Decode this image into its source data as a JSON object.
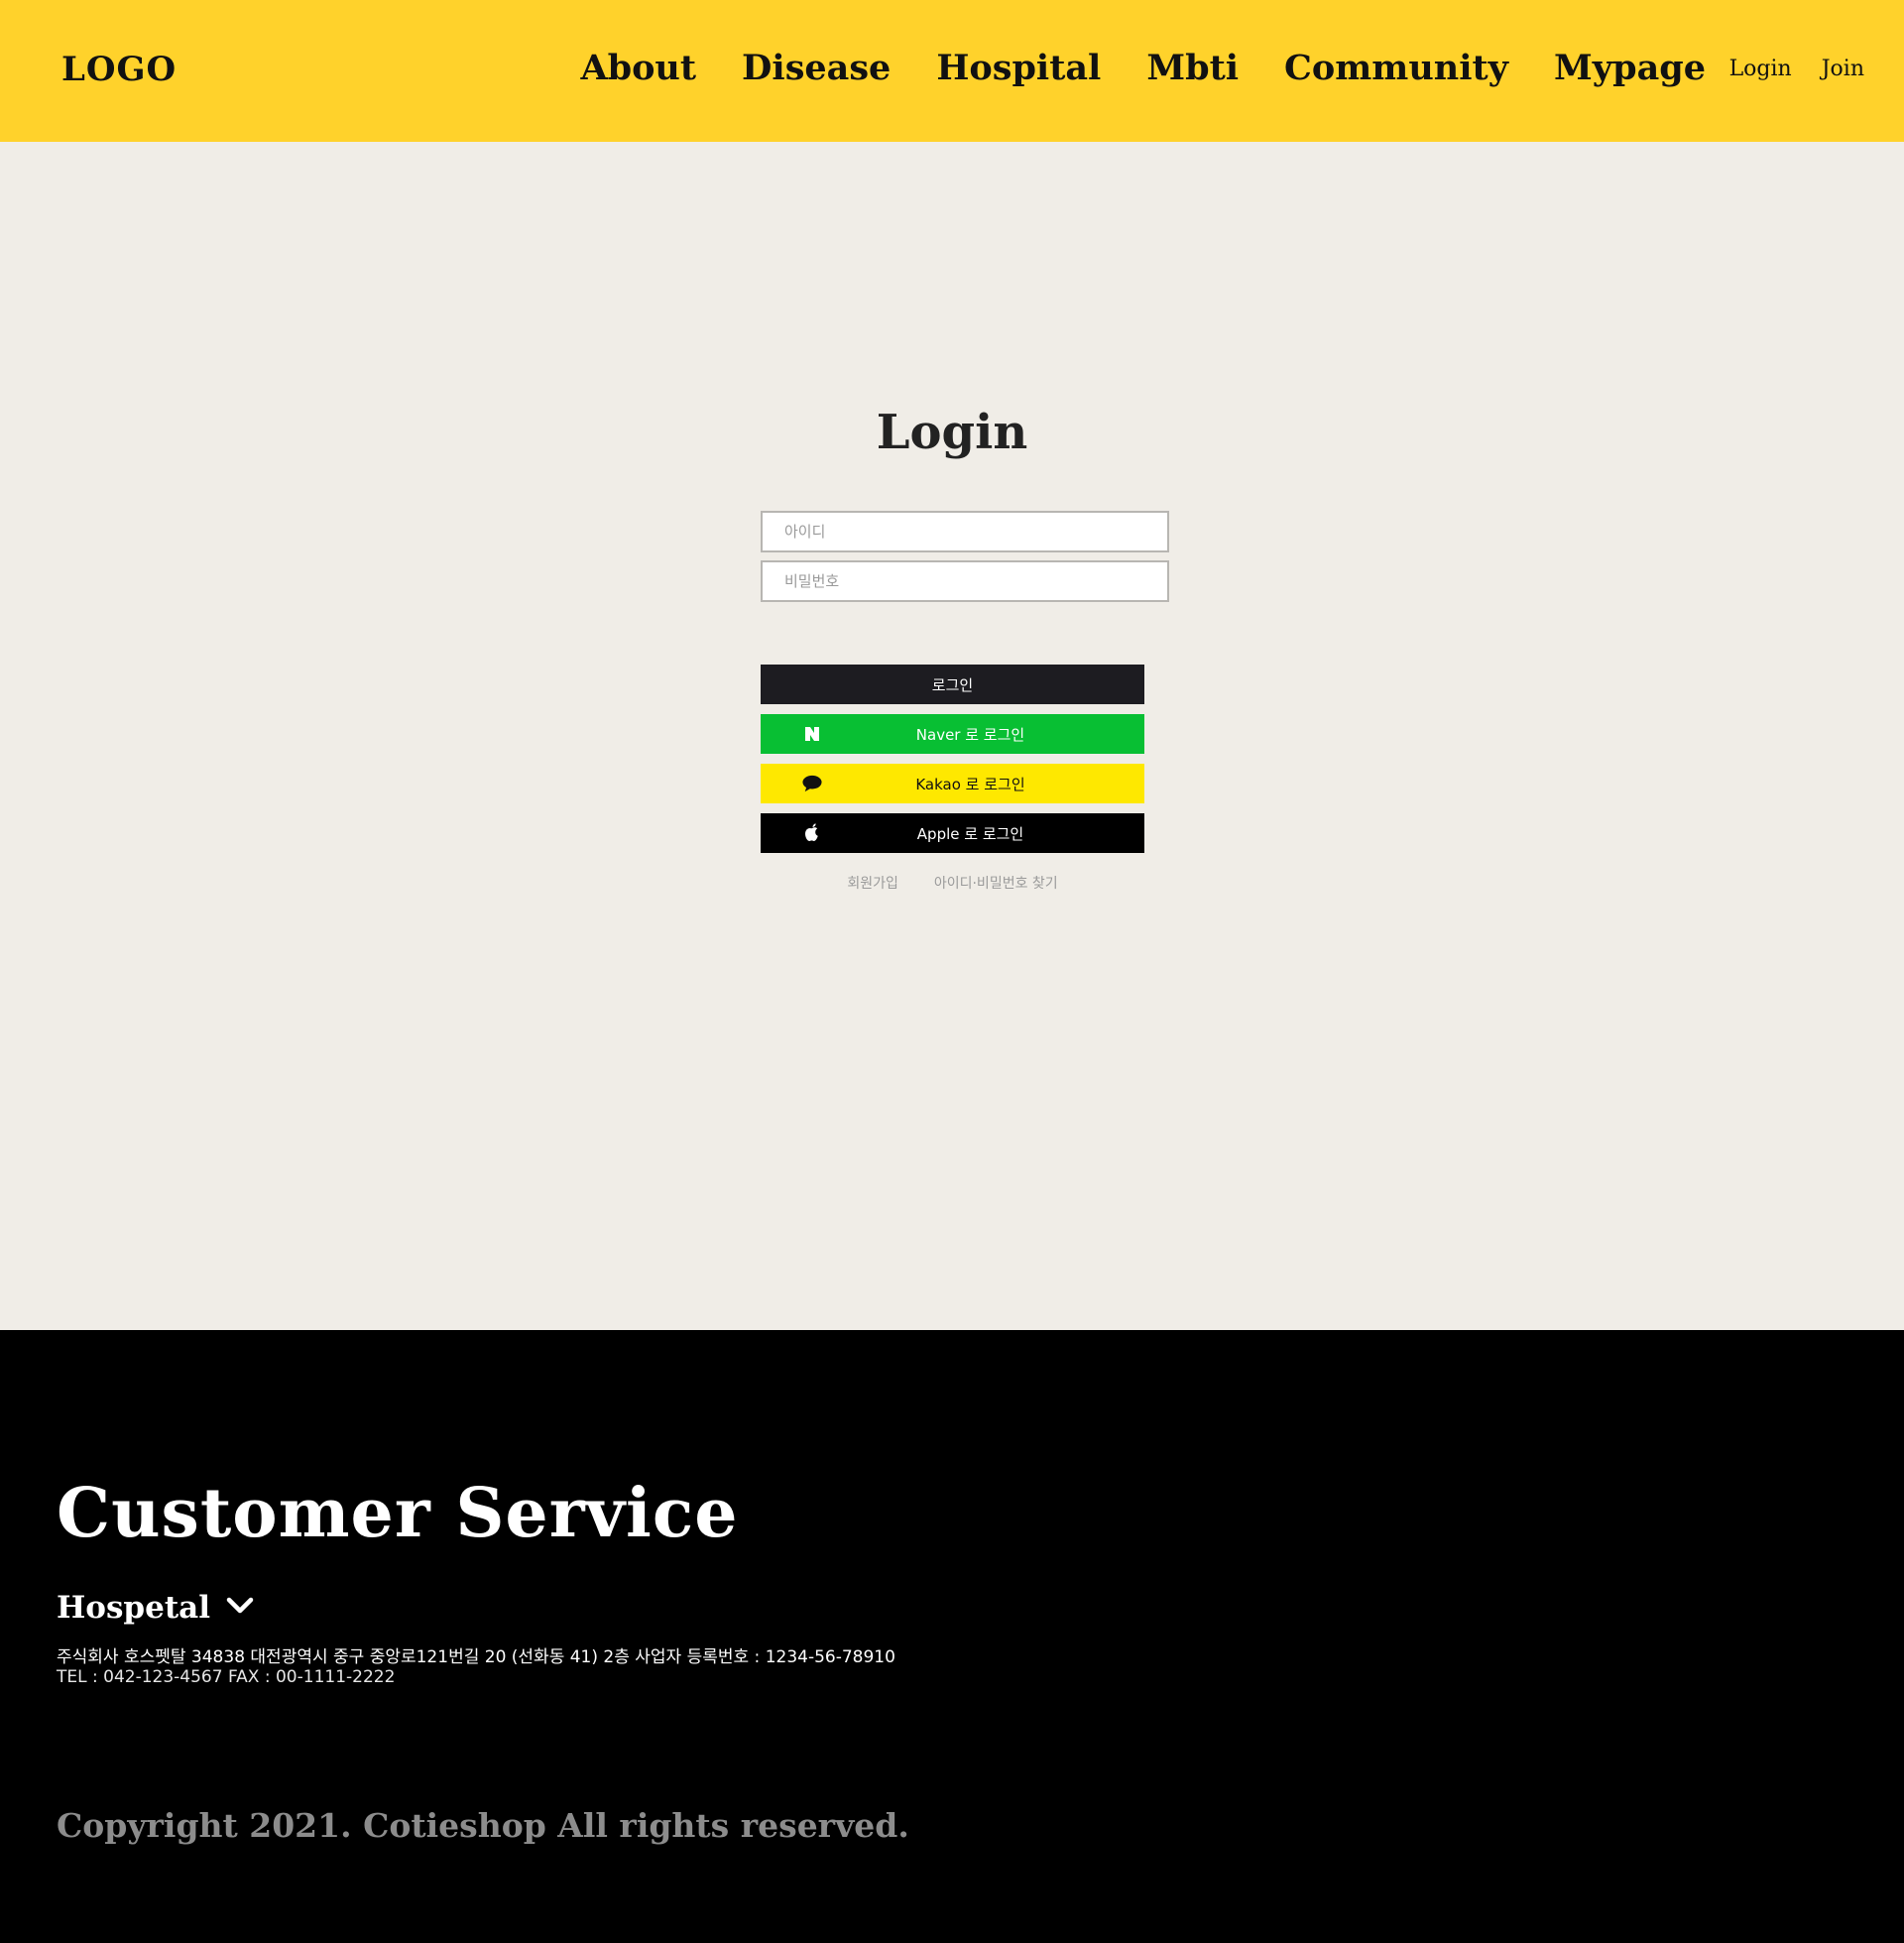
{
  "header": {
    "logo": "LOGO",
    "nav": [
      "About",
      "Disease",
      "Hospital",
      "Mbti",
      "Community",
      "Mypage"
    ],
    "util": {
      "login": "Login",
      "join": "Join"
    },
    "background_color": "#ffd22b"
  },
  "login": {
    "title": "Login",
    "id_placeholder": "아이디",
    "pw_placeholder": "비밀번호",
    "login_button": "로그인",
    "naver_button": "Naver 로 로그인",
    "kakao_button": "Kakao 로 로그인",
    "apple_button": "Apple 로 로그인",
    "signup_link": "회원가입",
    "find_link": "아이디·비밀번호 찾기",
    "colors": {
      "login": "#1d1c21",
      "naver": "#08bf33",
      "kakao": "#fee800",
      "apple": "#000000"
    }
  },
  "footer": {
    "title": "Customer Service",
    "company": "Hospetal",
    "info_line1": "주식회사 호스펫탈 34838 대전광역시 중구 중앙로121번길 20 (선화동 41) 2층  사업자 등록번호 : 1234-56-78910",
    "info_line2": "TEL : 042-123-4567 FAX : 00-1111-2222",
    "copyright": "Copyright 2021. Cotieshop All rights reserved."
  },
  "icons": [
    "naver-icon",
    "kakao-chat-icon",
    "apple-icon",
    "chevron-down-icon"
  ]
}
